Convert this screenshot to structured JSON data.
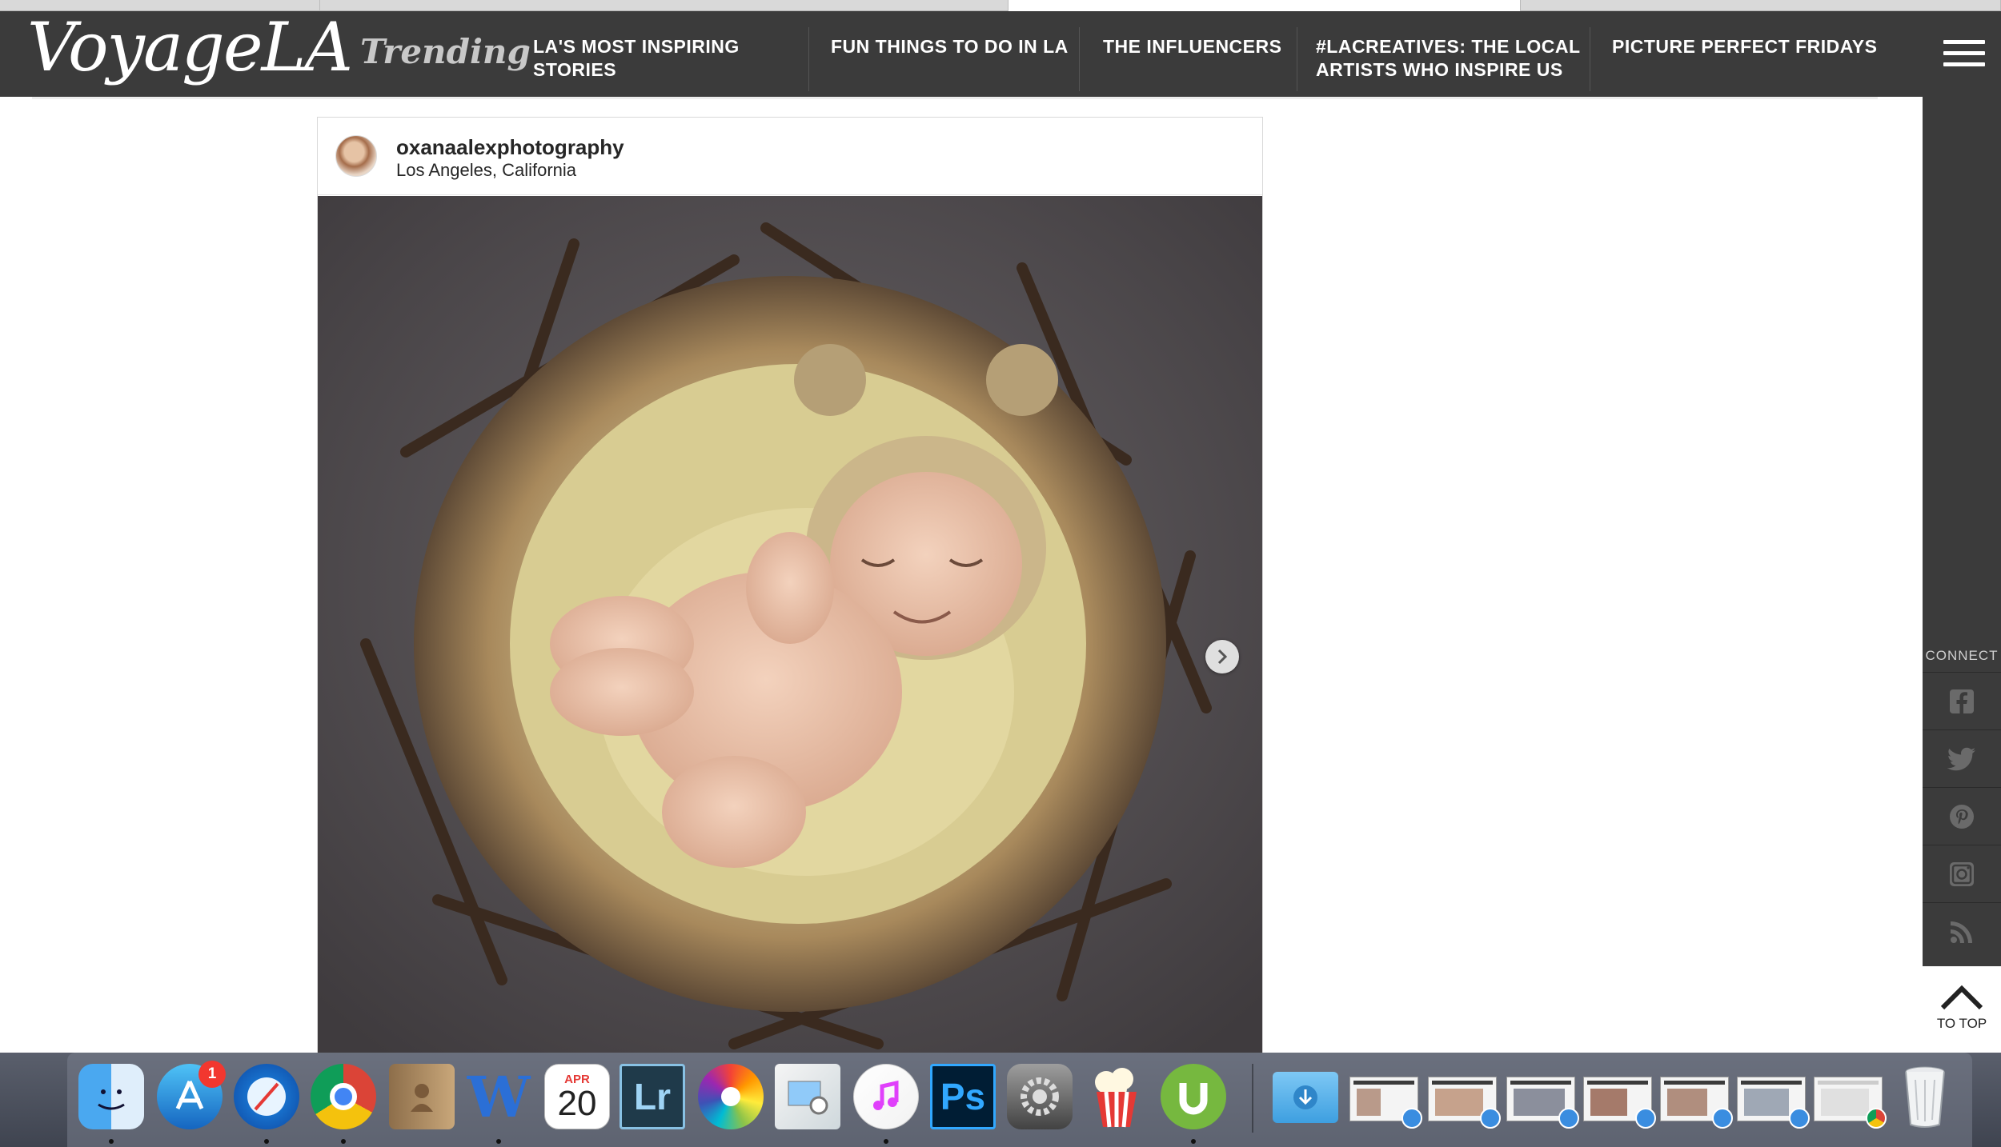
{
  "site": {
    "logo": "VoyageLA",
    "trending_label": "Trending"
  },
  "nav": {
    "items": [
      {
        "label_line1": "LA'S MOST INSPIRING",
        "label_line2": "STORIES"
      },
      {
        "label_line1": "FUN THINGS TO DO IN LA",
        "label_line2": ""
      },
      {
        "label_line1": "THE INFLUENCERS",
        "label_line2": ""
      },
      {
        "label_line1": "#LACREATIVES: THE LOCAL",
        "label_line2": "ARTISTS WHO INSPIRE US"
      },
      {
        "label_line1": "PICTURE PERFECT FRIDAYS",
        "label_line2": ""
      }
    ]
  },
  "sidebar": {
    "connect_label": "CONNECT",
    "social": [
      "facebook-icon",
      "twitter-icon",
      "pinterest-icon",
      "instagram-icon",
      "rss-icon"
    ],
    "to_top_label": "TO TOP"
  },
  "post": {
    "username": "oxanaalexphotography",
    "location": "Los Angeles, California"
  },
  "dock": {
    "apps": [
      "Finder",
      "App Store",
      "Safari",
      "Chrome",
      "Contacts",
      "Word",
      "Calendar",
      "Lightroom",
      "Photos",
      "Preview",
      "iTunes",
      "Photoshop",
      "System Preferences",
      "Popcorn Time",
      "uTorrent"
    ],
    "app_store_badge": "1",
    "calendar_month": "APR",
    "calendar_day": "20",
    "lightroom_label": "Lr",
    "photoshop_label": "Ps",
    "word_label": "W",
    "colors": {
      "lightroom_bg": "#1f3a4a",
      "photoshop_bg": "#001d34",
      "utorrent": "#76b83f"
    }
  }
}
